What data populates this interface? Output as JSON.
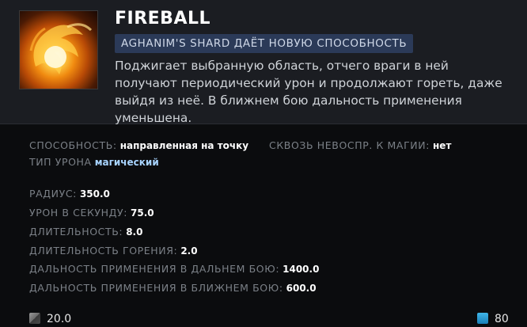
{
  "ability": {
    "title": "FIREBALL",
    "badge": "AGHANIM'S SHARD ДАЁТ НОВУЮ СПОСОБНОСТЬ",
    "description": "Поджигает выбранную область, отчего враги в ней получают периодический урон и продолжают гореть, даже выйдя из неё. В ближнем бою дальность применения уменьшена.",
    "icon": "fireball-icon"
  },
  "stats": {
    "ability_label": "СПОСОБНОСТЬ:",
    "ability_value": "направленная на точку",
    "pierces_label": "СКВОЗЬ НЕВОСПР. К МАГИИ:",
    "pierces_value": "нет",
    "damage_type_label": "ТИП УРОНА",
    "damage_type_value": "магический",
    "radius_label": "РАДИУС:",
    "radius_value": "350.0",
    "dps_label": "УРОН В СЕКУНДУ:",
    "dps_value": "75.0",
    "duration_label": "ДЛИТЕЛЬНОСТЬ:",
    "duration_value": "8.0",
    "burn_label": "ДЛИТЕЛЬНОСТЬ ГОРЕНИЯ:",
    "burn_value": "2.0",
    "range_ranged_label": "ДАЛЬНОСТЬ ПРИМЕНЕНИЯ В ДАЛЬНЕМ БОЮ:",
    "range_ranged_value": "1400.0",
    "range_melee_label": "ДАЛЬНОСТЬ ПРИМЕНЕНИЯ В БЛИЖНЕМ БОЮ:",
    "range_melee_value": "600.0"
  },
  "footer": {
    "cooldown": "20.0",
    "mana": "80",
    "cooldown_icon": "cooldown-icon",
    "mana_icon": "mana-icon"
  },
  "colors": {
    "header_bg": "#1b1d22",
    "body_bg": "#0b0c0e",
    "badge_bg": "#2b3a58",
    "magic_text": "#a8d4ff"
  }
}
